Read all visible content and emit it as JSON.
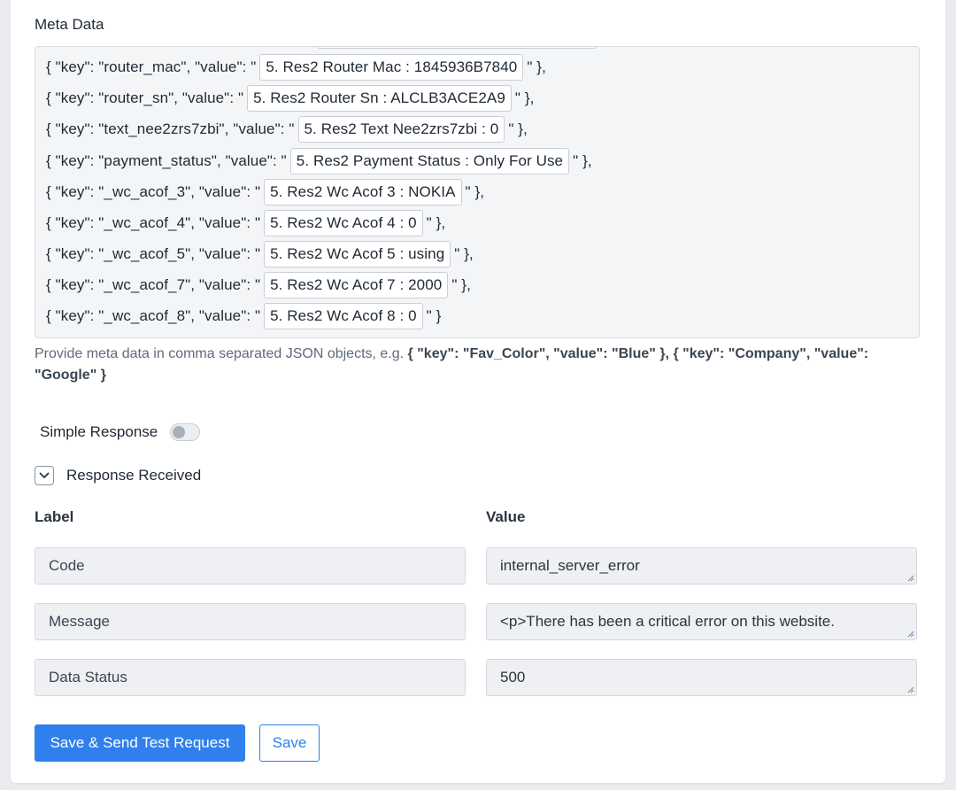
{
  "meta": {
    "title": "Meta Data",
    "lines": [
      {
        "prefix": "{ \"key\": \"router_mac\", \"value\": \"",
        "value": "5. Res2 Router Mac : 1845936B7840",
        "suffix": "\" },"
      },
      {
        "prefix": "{ \"key\": \"router_sn\", \"value\": \"",
        "value": "5. Res2 Router Sn : ALCLB3ACE2A9",
        "suffix": "\" },"
      },
      {
        "prefix": "{ \"key\": \"text_nee2zrs7zbi\", \"value\": \"",
        "value": "5. Res2 Text Nee2zrs7zbi : 0",
        "suffix": "\" },"
      },
      {
        "prefix": "{ \"key\": \"payment_status\", \"value\": \"",
        "value": "5. Res2 Payment Status : Only For Use",
        "suffix": "\" },"
      },
      {
        "prefix": "{ \"key\": \"_wc_acof_3\", \"value\": \"",
        "value": "5. Res2 Wc Acof 3 : NOKIA",
        "suffix": "\" },"
      },
      {
        "prefix": "{ \"key\": \"_wc_acof_4\", \"value\": \"",
        "value": "5. Res2 Wc Acof 4 : 0",
        "suffix": "\" },"
      },
      {
        "prefix": "{ \"key\": \"_wc_acof_5\", \"value\": \"",
        "value": "5. Res2 Wc Acof 5 : using",
        "suffix": "\" },"
      },
      {
        "prefix": "{ \"key\": \"_wc_acof_7\", \"value\": \"",
        "value": "5. Res2 Wc Acof 7 : 2000",
        "suffix": "\" },"
      },
      {
        "prefix": "{ \"key\": \"_wc_acof_8\", \"value\": \"",
        "value": "5. Res2 Wc Acof 8 : 0",
        "suffix": "\" }"
      }
    ],
    "help_text": "Provide meta data in comma separated JSON objects, e.g.",
    "help_example_1": "{ \"key\": \"Fav_Color\", \"value\": \"Blue\" },",
    "help_example_2": "{ \"key\": \"Company\", \"value\": \"Google\" }"
  },
  "simple_response": {
    "label": "Simple Response",
    "enabled": false
  },
  "response_received": {
    "label": "Response Received",
    "expanded": true
  },
  "table": {
    "label_header": "Label",
    "value_header": "Value",
    "rows": [
      {
        "label": "Code",
        "value": "internal_server_error"
      },
      {
        "label": "Message",
        "value": "<p>There has been a critical error on this website."
      },
      {
        "label": "Data Status",
        "value": "500"
      }
    ]
  },
  "buttons": {
    "primary": "Save & Send Test Request",
    "secondary": "Save"
  },
  "colors": {
    "accent": "#2f80ed",
    "field_bg": "#eef0f3",
    "page_bg": "#e9ebef"
  }
}
